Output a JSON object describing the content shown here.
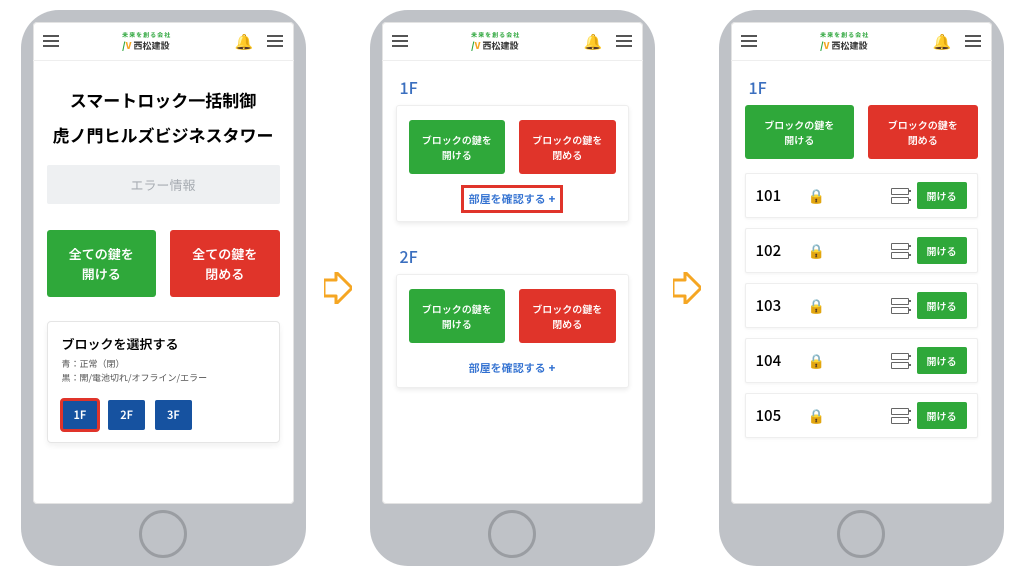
{
  "brand": {
    "tagline": "未来を創る会社",
    "name": "西松建設"
  },
  "screen1": {
    "title": "スマートロック一括制御",
    "subtitle": "虎ノ門ヒルズビジネスタワー",
    "error_info": "エラー情報",
    "open_all": "全ての鍵を\n開ける",
    "close_all": "全ての鍵を\n閉める",
    "select_block": "ブロックを選択する",
    "legend_blue": "青：正常（閉）",
    "legend_black": "黒：開/電池切れ/オフライン/エラー",
    "floors": [
      "1F",
      "2F",
      "3F"
    ]
  },
  "screen2": {
    "floors": [
      {
        "label": "1F",
        "open": "ブロックの鍵を\n開ける",
        "close": "ブロックの鍵を\n閉める",
        "confirm": "部屋を確認する"
      },
      {
        "label": "2F",
        "open": "ブロックの鍵を\n開ける",
        "close": "ブロックの鍵を\n閉める",
        "confirm": "部屋を確認する"
      }
    ]
  },
  "screen3": {
    "floor": "1F",
    "open": "ブロックの鍵を\n開ける",
    "close": "ブロックの鍵を\n閉める",
    "open_btn": "開ける",
    "rooms": [
      "101",
      "102",
      "103",
      "104",
      "105"
    ]
  }
}
